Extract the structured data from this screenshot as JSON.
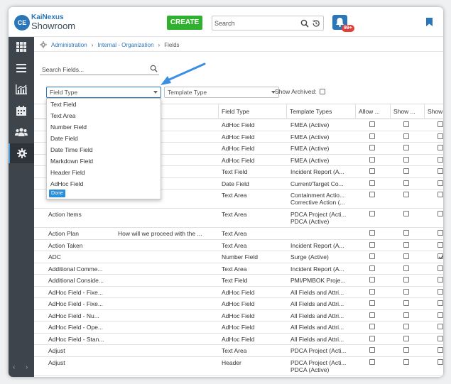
{
  "header": {
    "logo_top": "KaiNexus",
    "logo_bottom": "Showroom",
    "logo_badge": "CE",
    "create_label": "CREATE",
    "search_placeholder": "Search",
    "notification_count": "99+"
  },
  "breadcrumb": {
    "items": [
      "Administration",
      "Internal - Organization",
      "Fields"
    ]
  },
  "filters": {
    "search_placeholder": "Search Fields...",
    "field_type_placeholder": "Field Type",
    "template_type_placeholder": "Template Type",
    "show_archived_label": "Show Archived:"
  },
  "dropdown": {
    "options": [
      "Text Field",
      "Text Area",
      "Number Field",
      "Date Field",
      "Date Time Field",
      "Markdown Field",
      "Header Field",
      "AdHoc Field"
    ],
    "done_label": "Done"
  },
  "table": {
    "columns": [
      "",
      "Field Type",
      "Template Types",
      "Allow ...",
      "Show ...",
      "Show ..."
    ],
    "rows": [
      {
        "name": "",
        "desc": "",
        "type": "AdHoc Field",
        "templates": [
          "FMEA (Active)"
        ],
        "checks": [
          false,
          false,
          false
        ]
      },
      {
        "name": "",
        "desc": "",
        "type": "AdHoc Field",
        "templates": [
          "FMEA (Active)"
        ],
        "checks": [
          false,
          false,
          false
        ]
      },
      {
        "name": "",
        "desc": "",
        "type": "AdHoc Field",
        "templates": [
          "FMEA (Active)"
        ],
        "checks": [
          false,
          false,
          false
        ]
      },
      {
        "name": "",
        "desc": "",
        "type": "AdHoc Field",
        "templates": [
          "FMEA (Active)"
        ],
        "checks": [
          false,
          false,
          false
        ]
      },
      {
        "name": "",
        "desc": "",
        "type": "Text Field",
        "templates": [
          "Incident Report (A..."
        ],
        "checks": [
          false,
          false,
          false
        ]
      },
      {
        "name": "",
        "desc": "",
        "type": "Date Field",
        "templates": [
          "Current/Target Co..."
        ],
        "checks": [
          false,
          false,
          false
        ]
      },
      {
        "name": "",
        "desc": "",
        "type": "Text Area",
        "templates": [
          "Containment Actio...",
          "Corrective Action (..."
        ],
        "checks": [
          false,
          false,
          false
        ]
      },
      {
        "name": "Action Items",
        "desc": "",
        "type": "Text Area",
        "templates": [
          "PDCA Project (Acti...",
          "PDCA (Active)"
        ],
        "checks": [
          false,
          false,
          false
        ]
      },
      {
        "name": "Action Plan",
        "desc": "How will we proceed with the ...",
        "type": "Text Area",
        "templates": [
          ""
        ],
        "checks": [
          false,
          false,
          false
        ]
      },
      {
        "name": "Action Taken",
        "desc": "",
        "type": "Text Area",
        "templates": [
          "Incident Report (A..."
        ],
        "checks": [
          false,
          false,
          false
        ]
      },
      {
        "name": "ADC",
        "desc": "",
        "type": "Number Field",
        "templates": [
          "Surge (Active)"
        ],
        "checks": [
          false,
          false,
          true
        ]
      },
      {
        "name": "Additional Comme...",
        "desc": "",
        "type": "Text Area",
        "templates": [
          "Incident Report (A..."
        ],
        "checks": [
          false,
          false,
          false
        ]
      },
      {
        "name": "Additional Conside...",
        "desc": "",
        "type": "Text Field",
        "templates": [
          "PMI/PMBOK Proje..."
        ],
        "checks": [
          false,
          false,
          false
        ]
      },
      {
        "name": "AdHoc Field - Fixe...",
        "desc": "",
        "type": "AdHoc Field",
        "templates": [
          "All Fields and Attri..."
        ],
        "checks": [
          false,
          false,
          false
        ]
      },
      {
        "name": "AdHoc Field - Fixe...",
        "desc": "",
        "type": "AdHoc Field",
        "templates": [
          "All Fields and Attri..."
        ],
        "checks": [
          false,
          false,
          false
        ]
      },
      {
        "name": "AdHoc Field - Nu...",
        "desc": "",
        "type": "AdHoc Field",
        "templates": [
          "All Fields and Attri..."
        ],
        "checks": [
          false,
          false,
          false
        ]
      },
      {
        "name": "AdHoc Field - Ope...",
        "desc": "",
        "type": "AdHoc Field",
        "templates": [
          "All Fields and Attri..."
        ],
        "checks": [
          false,
          false,
          false
        ]
      },
      {
        "name": "AdHoc Field - Stan...",
        "desc": "",
        "type": "AdHoc Field",
        "templates": [
          "All Fields and Attri..."
        ],
        "checks": [
          false,
          false,
          false
        ]
      },
      {
        "name": "Adjust",
        "desc": "",
        "type": "Text Area",
        "templates": [
          "PDCA Project (Acti..."
        ],
        "checks": [
          false,
          false,
          false
        ]
      },
      {
        "name": "Adjust",
        "desc": "",
        "type": "Header",
        "templates": [
          "PDCA Project (Acti...",
          "PDCA (Active)"
        ],
        "checks": [
          false,
          false,
          false
        ]
      }
    ]
  },
  "sidebar": {
    "items": [
      "grid-icon",
      "list-icon",
      "chart-icon",
      "calendar-icon",
      "people-icon",
      "gear-icon"
    ]
  },
  "colors": {
    "accent": "#2a76b8",
    "create": "#2fb12f",
    "sidebar": "#3d444b"
  }
}
